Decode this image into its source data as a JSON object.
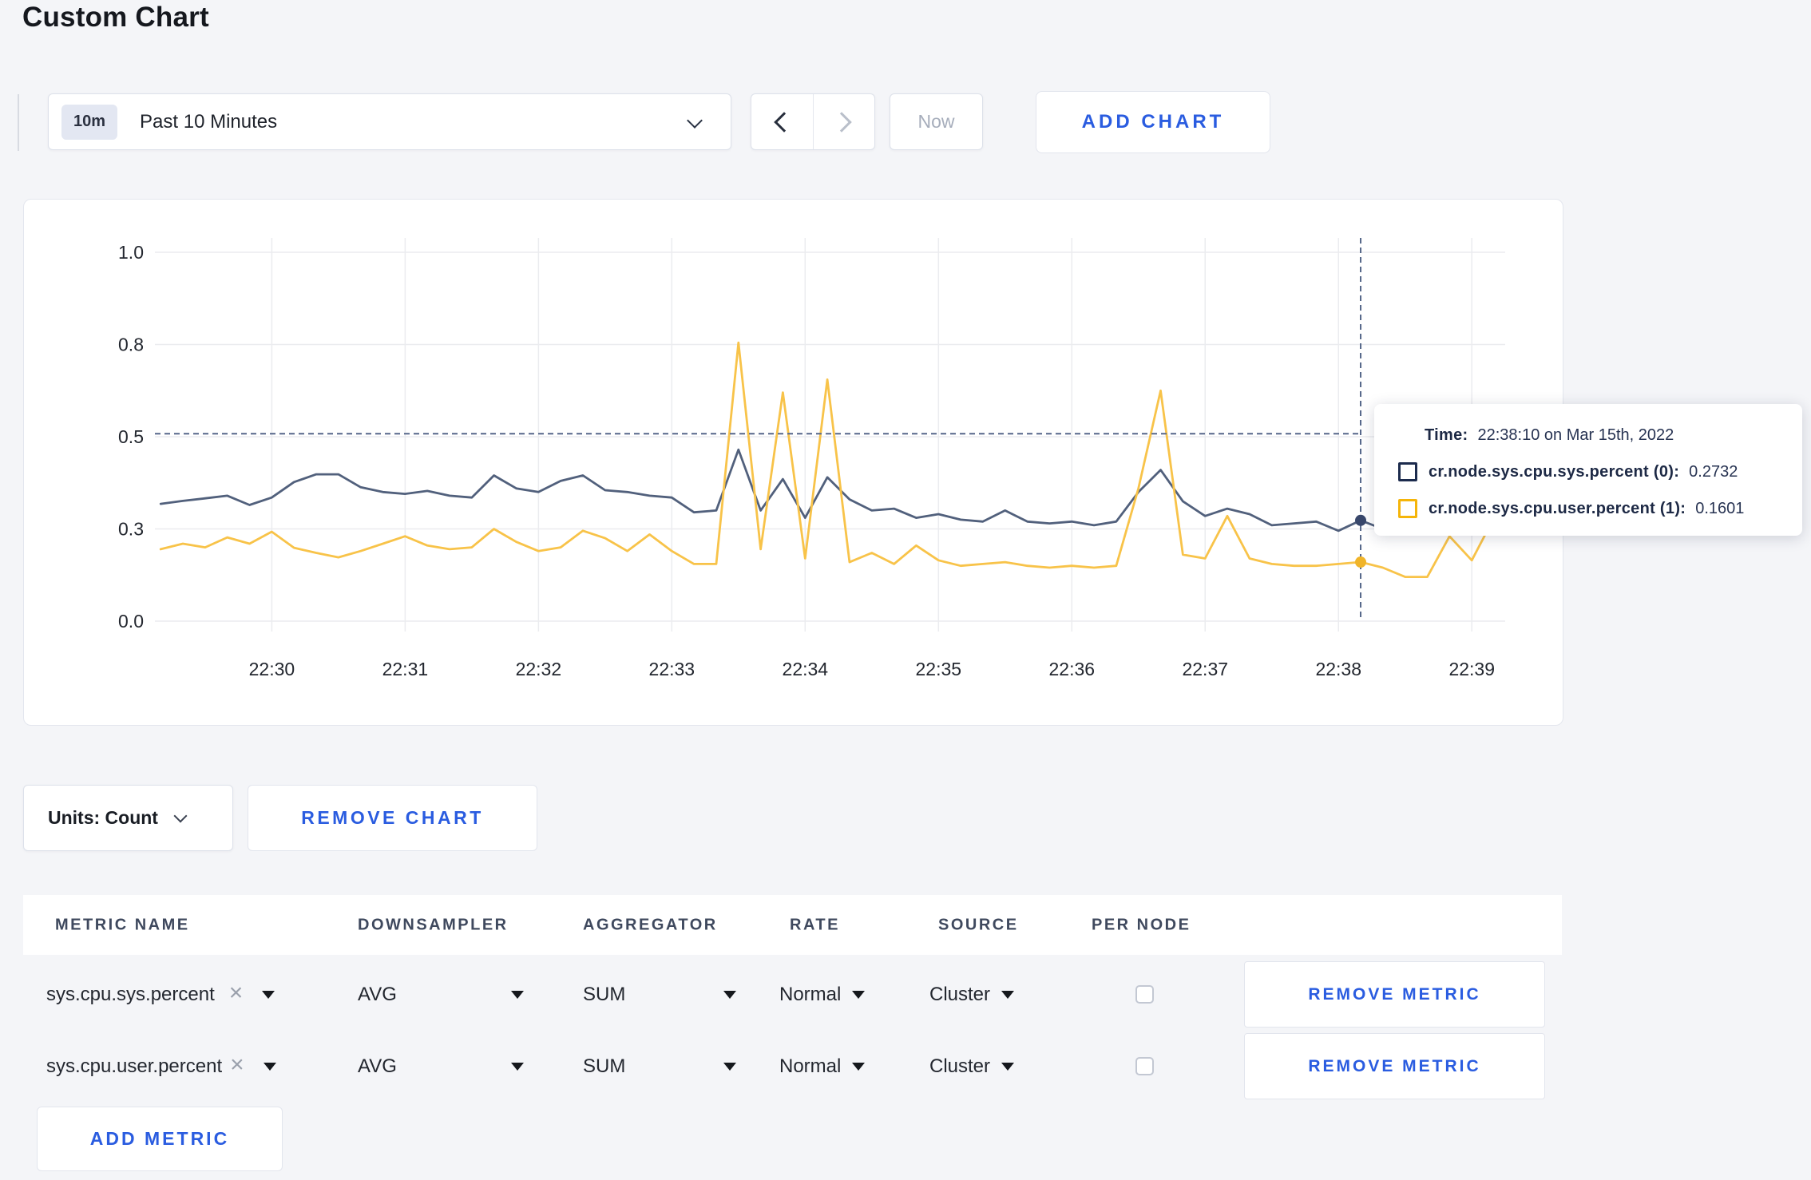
{
  "page": {
    "title": "Custom Chart",
    "background": "#f4f5f8",
    "accent_blue": "#2a5ce0"
  },
  "toolbar": {
    "time_range": {
      "badge": "10m",
      "label": "Past 10 Minutes"
    },
    "now_label": "Now",
    "add_chart_label": "ADD CHART"
  },
  "tooltip": {
    "time_label": "Time:",
    "time_value": "22:38:10 on Mar 15th, 2022",
    "series": [
      {
        "label": "cr.node.sys.cpu.sys.percent (0):",
        "value": "0.2732",
        "color": "#1c2b4d"
      },
      {
        "label": "cr.node.sys.cpu.user.percent (1):",
        "value": "0.1601",
        "color": "#f5b50a"
      }
    ]
  },
  "chart_footer": {
    "units_label": "Units: Count",
    "remove_chart_label": "REMOVE CHART"
  },
  "metrics_table": {
    "headers": [
      "METRIC NAME",
      "DOWNSAMPLER",
      "AGGREGATOR",
      "RATE",
      "SOURCE",
      "PER NODE"
    ],
    "icons": {
      "clear": "×"
    },
    "rows": [
      {
        "metric": "sys.cpu.sys.percent",
        "downsampler": "AVG",
        "aggregator": "SUM",
        "rate": "Normal",
        "source": "Cluster",
        "per_node": false,
        "remove_label": "REMOVE METRIC"
      },
      {
        "metric": "sys.cpu.user.percent",
        "downsampler": "AVG",
        "aggregator": "SUM",
        "rate": "Normal",
        "source": "Cluster",
        "per_node": false,
        "remove_label": "REMOVE METRIC"
      }
    ],
    "add_metric_label": "ADD METRIC"
  },
  "chart_data": {
    "type": "line",
    "title": "",
    "xlabel": "",
    "ylabel": "",
    "grid": true,
    "legend_position": "tooltip",
    "ylim": [
      0,
      1.15
    ],
    "x_start": "22:29:10",
    "x_step_seconds": 10,
    "x_ticks": [
      "22:30",
      "22:31",
      "22:32",
      "22:33",
      "22:34",
      "22:35",
      "22:36",
      "22:37",
      "22:38",
      "22:39"
    ],
    "y_ticks": [
      {
        "label": "1.0",
        "value": 1.0
      },
      {
        "label": "0.8",
        "value": 0.75
      },
      {
        "label": "0.5",
        "value": 0.5
      },
      {
        "label": "0.3",
        "value": 0.25
      },
      {
        "label": "0.0",
        "value": 0.0
      }
    ],
    "series": [
      {
        "name": "cr.node.sys.cpu.sys.percent",
        "color": "#51607c",
        "values": [
          0.318,
          0.326,
          0.333,
          0.34,
          0.315,
          0.335,
          0.377,
          0.398,
          0.398,
          0.363,
          0.35,
          0.345,
          0.353,
          0.34,
          0.335,
          0.395,
          0.36,
          0.35,
          0.38,
          0.395,
          0.355,
          0.35,
          0.34,
          0.335,
          0.295,
          0.3,
          0.465,
          0.3,
          0.385,
          0.28,
          0.39,
          0.33,
          0.3,
          0.305,
          0.28,
          0.29,
          0.275,
          0.27,
          0.3,
          0.27,
          0.265,
          0.27,
          0.26,
          0.27,
          0.35,
          0.41,
          0.325,
          0.285,
          0.305,
          0.29,
          0.26,
          0.265,
          0.27,
          0.245,
          0.2732,
          0.25,
          0.26,
          0.27,
          0.26,
          0.27,
          0.29
        ]
      },
      {
        "name": "cr.node.sys.cpu.user.percent",
        "color": "#f8c349",
        "values": [
          0.195,
          0.21,
          0.2,
          0.227,
          0.21,
          0.2425,
          0.199,
          0.185,
          0.173,
          0.19,
          0.21,
          0.23,
          0.205,
          0.195,
          0.2,
          0.25,
          0.215,
          0.19,
          0.2,
          0.245,
          0.225,
          0.19,
          0.235,
          0.19,
          0.155,
          0.155,
          0.755,
          0.195,
          0.62,
          0.17,
          0.655,
          0.16,
          0.185,
          0.155,
          0.205,
          0.165,
          0.15,
          0.155,
          0.16,
          0.15,
          0.145,
          0.15,
          0.145,
          0.15,
          0.36,
          0.625,
          0.18,
          0.17,
          0.285,
          0.17,
          0.155,
          0.15,
          0.15,
          0.155,
          0.1601,
          0.145,
          0.12,
          0.12,
          0.23,
          0.165,
          0.28
        ]
      }
    ],
    "crosshair": {
      "time": "22:38:10",
      "x_index": 54,
      "hline_value": 0.508,
      "points": [
        {
          "series": "cr.node.sys.cpu.sys.percent",
          "value": 0.2732,
          "color": "#38476b"
        },
        {
          "series": "cr.node.sys.cpu.user.percent",
          "value": 0.1601,
          "color": "#f0b429"
        }
      ]
    }
  }
}
